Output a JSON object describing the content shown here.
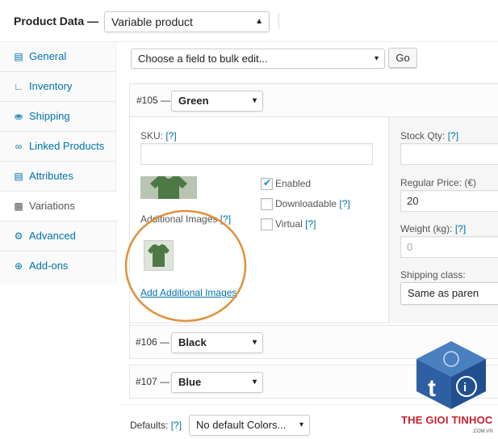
{
  "header": {
    "label": "Product Data —",
    "product_type": "Variable product"
  },
  "tabs": [
    {
      "label": "General",
      "icon": "wrench-icon"
    },
    {
      "label": "Inventory",
      "icon": "chart-icon"
    },
    {
      "label": "Shipping",
      "icon": "truck-icon"
    },
    {
      "label": "Linked Products",
      "icon": "link-icon"
    },
    {
      "label": "Attributes",
      "icon": "list-icon"
    },
    {
      "label": "Variations",
      "icon": "grid-icon",
      "active": true
    },
    {
      "label": "Advanced",
      "icon": "gear-icon"
    },
    {
      "label": "Add-ons",
      "icon": "plus-circle-icon"
    }
  ],
  "bulk_edit": {
    "placeholder": "Choose a field to bulk edit...",
    "go_label": "Go"
  },
  "variations": [
    {
      "id_label": "#105 —",
      "attribute_value": "Green",
      "expanded": true
    },
    {
      "id_label": "#106 —",
      "attribute_value": "Black",
      "expanded": false
    },
    {
      "id_label": "#107 —",
      "attribute_value": "Blue",
      "expanded": false
    }
  ],
  "variation_detail": {
    "sku_label": "SKU:",
    "help_link": "[?]",
    "sku_value": "",
    "enabled_label": "Enabled",
    "enabled_checked": true,
    "downloadable_label": "Downloadable",
    "downloadable_checked": false,
    "virtual_label": "Virtual",
    "virtual_checked": false,
    "additional_images_label": "Additional Images",
    "add_images_link": "Add Additional Images",
    "stock_qty_label": "Stock Qty:",
    "stock_qty_value": "",
    "regular_price_label": "Regular Price: (€)",
    "regular_price_value": "20",
    "weight_label": "Weight (kg):",
    "weight_placeholder": "0",
    "shipping_class_label": "Shipping class:",
    "shipping_class_value": "Same as paren"
  },
  "defaults": {
    "label": "Defaults:",
    "help_link": "[?]",
    "value": "No default Colors..."
  },
  "watermark": {
    "brand": "THE GIOI TINHOC",
    "domain": ".COM.VN"
  },
  "colors": {
    "link": "#0073aa",
    "highlight_circle": "#e0913a",
    "shirt_green": "#4d7a44",
    "brand_red": "#c8202f",
    "brand_blue": "#2f5fa3"
  }
}
